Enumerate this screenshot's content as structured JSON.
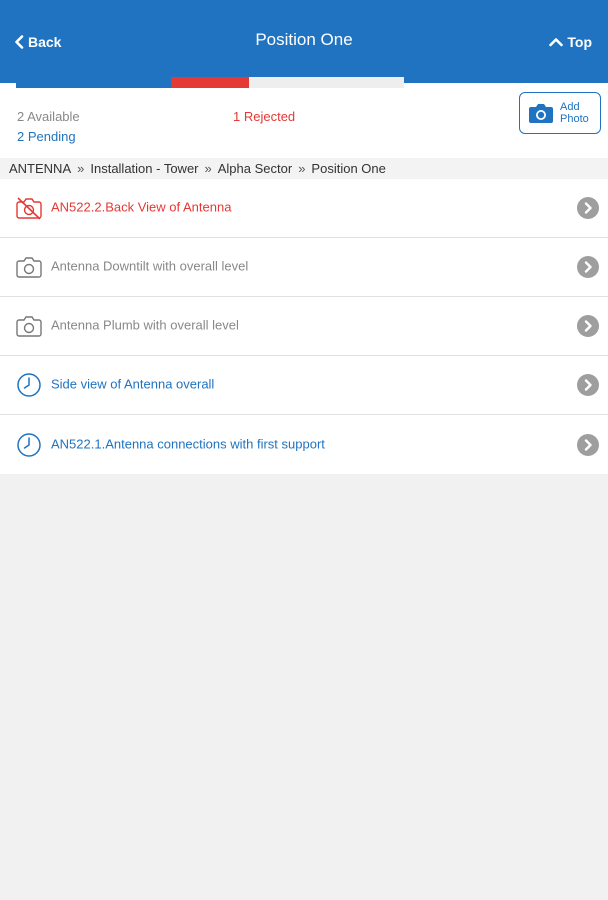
{
  "header": {
    "back_label": "Back",
    "title": "Position One",
    "top_label": "Top",
    "background_color": "#1f73c0"
  },
  "progress": {
    "available_fraction": 0.4,
    "rejected_fraction": 0.2,
    "pending_fraction": 0.4,
    "colors": {
      "available": "#1f73c0",
      "rejected": "#e53935",
      "remaining": "#eeeeee"
    }
  },
  "stats": {
    "available": "2 Available",
    "pending": "2 Pending",
    "rejected": "1 Rejected"
  },
  "add_photo": {
    "line1": "Add",
    "line2": "Photo",
    "icon": "camera-icon"
  },
  "breadcrumb": [
    "ANTENNA",
    "Installation - Tower",
    "Alpha Sector",
    "Position One"
  ],
  "breadcrumb_separator": "»",
  "items": [
    {
      "label": "AN522.2.Back View of Antenna",
      "status": "rejected",
      "icon": "camera-off-icon"
    },
    {
      "label": "Antenna Downtilt with overall level",
      "status": "available",
      "icon": "camera-icon"
    },
    {
      "label": "Antenna Plumb with overall level",
      "status": "available",
      "icon": "camera-icon"
    },
    {
      "label": "Side view of Antenna overall",
      "status": "pending",
      "icon": "clock-icon"
    },
    {
      "label": "AN522.1.Antenna connections with first support",
      "status": "pending",
      "icon": "clock-icon"
    }
  ]
}
